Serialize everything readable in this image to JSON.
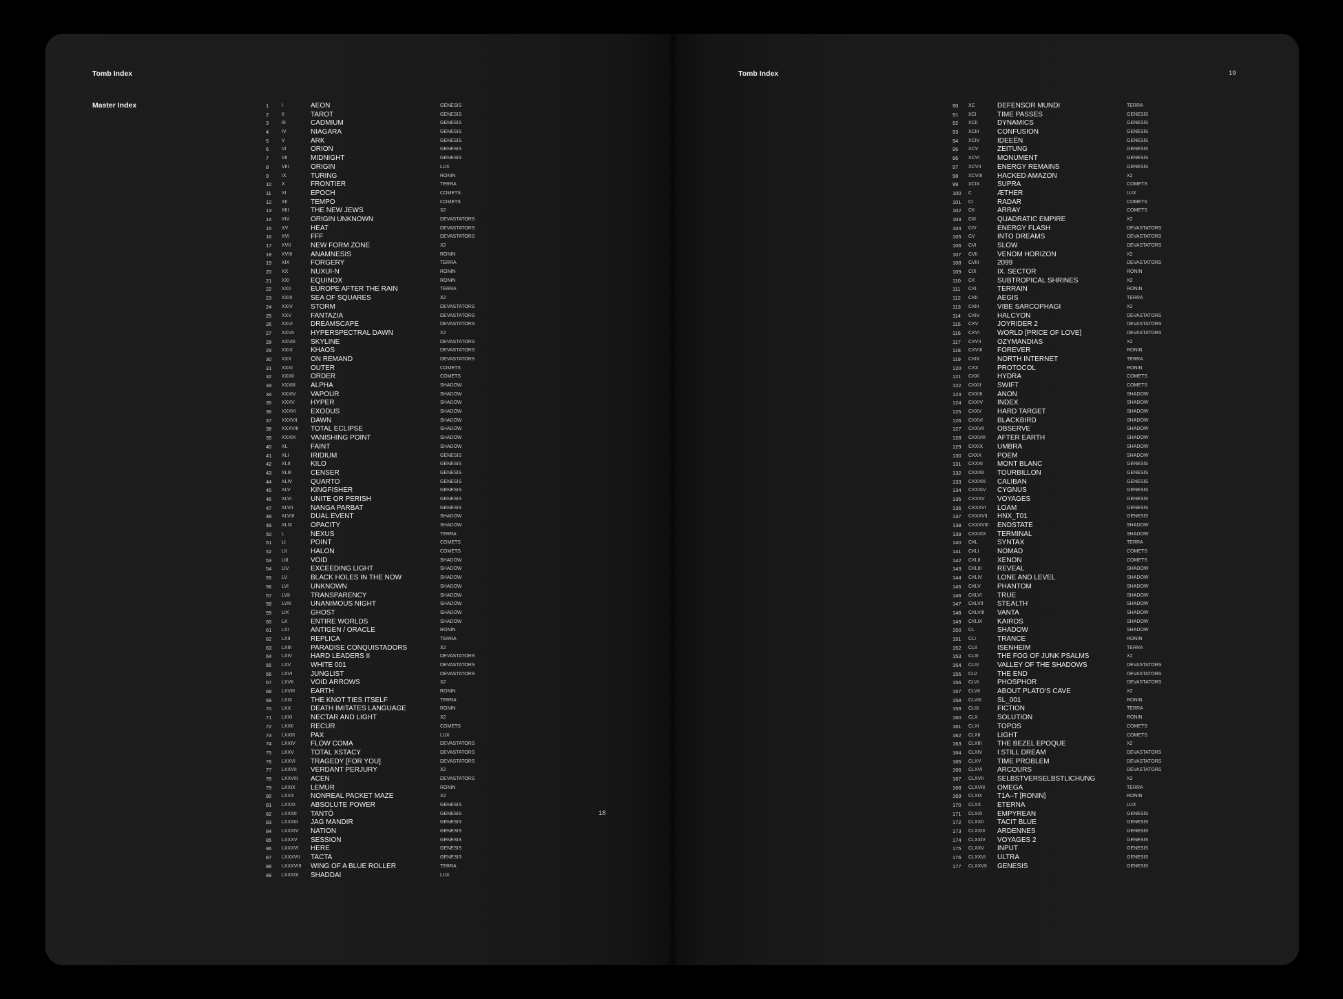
{
  "left_page": {
    "header": "Tomb Index",
    "section": "Master Index",
    "page_number": "18",
    "entries": [
      {
        "n": "1",
        "r": "I",
        "t": "AEON",
        "c": "GENESIS"
      },
      {
        "n": "2",
        "r": "II",
        "t": "TAROT",
        "c": "GENESIS"
      },
      {
        "n": "3",
        "r": "III",
        "t": "CADMIUM",
        "c": "GENESIS"
      },
      {
        "n": "4",
        "r": "IV",
        "t": "NIAGARA",
        "c": "GENESIS"
      },
      {
        "n": "5",
        "r": "V",
        "t": "ARK",
        "c": "GENESIS"
      },
      {
        "n": "6",
        "r": "VI",
        "t": "ORION",
        "c": "GENESIS"
      },
      {
        "n": "7",
        "r": "VII",
        "t": "MIDNIGHT",
        "c": "GENESIS"
      },
      {
        "n": "8",
        "r": "VIII",
        "t": "ORIGIN",
        "c": "LUX"
      },
      {
        "n": "9",
        "r": "IX",
        "t": "TURING",
        "c": "RONIN"
      },
      {
        "n": "10",
        "r": "X",
        "t": "FRONTIER",
        "c": "TERRA"
      },
      {
        "n": "11",
        "r": "XI",
        "t": "EPOCH",
        "c": "COMETS"
      },
      {
        "n": "12",
        "r": "XII",
        "t": "TEMPO",
        "c": "COMETS"
      },
      {
        "n": "13",
        "r": "XIII",
        "t": "THE NEW JEWS",
        "c": "X2"
      },
      {
        "n": "14",
        "r": "XIV",
        "t": "ORIGIN UNKNOWN",
        "c": "DEVASTATORS"
      },
      {
        "n": "15",
        "r": "XV",
        "t": "HEAT",
        "c": "DEVASTATORS"
      },
      {
        "n": "16",
        "r": "XVI",
        "t": "FFF",
        "c": "DEVASTATORS"
      },
      {
        "n": "17",
        "r": "XVII",
        "t": "NEW FORM ZONE",
        "c": "X2"
      },
      {
        "n": "18",
        "r": "XVIII",
        "t": "ANAMNESIS",
        "c": "RONIN"
      },
      {
        "n": "19",
        "r": "XIX",
        "t": "FORGERY",
        "c": "TERRA"
      },
      {
        "n": "20",
        "r": "XX",
        "t": "NUXUI-N",
        "c": "RONIN"
      },
      {
        "n": "21",
        "r": "XXI",
        "t": "EQUINOX",
        "c": "RONIN"
      },
      {
        "n": "22",
        "r": "XXII",
        "t": "EUROPE AFTER THE RAIN",
        "c": "TERRA"
      },
      {
        "n": "23",
        "r": "XXIII",
        "t": "SEA OF SQUARES",
        "c": "X2"
      },
      {
        "n": "24",
        "r": "XXIV",
        "t": "STORM",
        "c": "DEVASTATORS"
      },
      {
        "n": "25",
        "r": "XXV",
        "t": "FANTAZIA",
        "c": "DEVASTATORS"
      },
      {
        "n": "26",
        "r": "XXVI",
        "t": "DREAMSCAPE",
        "c": "DEVASTATORS"
      },
      {
        "n": "27",
        "r": "XXVII",
        "t": "HYPERSPECTRAL DAWN",
        "c": "X2"
      },
      {
        "n": "28",
        "r": "XXVIII",
        "t": "SKYLINE",
        "c": "DEVASTATORS"
      },
      {
        "n": "29",
        "r": "XXIX",
        "t": "KHAOS",
        "c": "DEVASTATORS"
      },
      {
        "n": "30",
        "r": "XXX",
        "t": "ON REMAND",
        "c": "DEVASTATORS"
      },
      {
        "n": "31",
        "r": "XXXI",
        "t": "OUTER",
        "c": "COMETS"
      },
      {
        "n": "32",
        "r": "XXXII",
        "t": "ORDER",
        "c": "COMETS"
      },
      {
        "n": "33",
        "r": "XXXIII",
        "t": "ALPHA",
        "c": "SHADOW"
      },
      {
        "n": "34",
        "r": "XXXIV",
        "t": "VAPOUR",
        "c": "SHADOW"
      },
      {
        "n": "35",
        "r": "XXXV",
        "t": "HYPER",
        "c": "SHADOW"
      },
      {
        "n": "36",
        "r": "XXXVI",
        "t": "EXODUS",
        "c": "SHADOW"
      },
      {
        "n": "37",
        "r": "XXXVII",
        "t": "DAWN",
        "c": "SHADOW"
      },
      {
        "n": "38",
        "r": "XXXVIII",
        "t": "TOTAL ECLIPSE",
        "c": "SHADOW"
      },
      {
        "n": "39",
        "r": "XXXIX",
        "t": "VANISHING POINT",
        "c": "SHADOW"
      },
      {
        "n": "40",
        "r": "XL",
        "t": "FAINT",
        "c": "SHADOW"
      },
      {
        "n": "41",
        "r": "XLI",
        "t": "IRIDIUM",
        "c": "GENESIS"
      },
      {
        "n": "42",
        "r": "XLII",
        "t": "KILO",
        "c": "GENESIS"
      },
      {
        "n": "43",
        "r": "XLIII",
        "t": "CENSER",
        "c": "GENESIS"
      },
      {
        "n": "44",
        "r": "XLIV",
        "t": "QUARTO",
        "c": "GENESIS"
      },
      {
        "n": "45",
        "r": "XLV",
        "t": "KINGFISHER",
        "c": "GENESIS"
      },
      {
        "n": "46",
        "r": "XLVI",
        "t": "UNITE OR PERISH",
        "c": "GENESIS"
      },
      {
        "n": "47",
        "r": "XLVII",
        "t": "NANGA PARBAT",
        "c": "GENESIS"
      },
      {
        "n": "48",
        "r": "XLVIII",
        "t": "DUAL EVENT",
        "c": "SHADOW"
      },
      {
        "n": "49",
        "r": "XLIX",
        "t": "OPACITY",
        "c": "SHADOW"
      },
      {
        "n": "50",
        "r": "L",
        "t": "NEXUS",
        "c": "TERRA"
      },
      {
        "n": "51",
        "r": "LI",
        "t": "POINT",
        "c": "COMETS"
      },
      {
        "n": "52",
        "r": "LII",
        "t": "HALON",
        "c": "COMETS"
      },
      {
        "n": "53",
        "r": "LIII",
        "t": "VOID",
        "c": "SHADOW"
      },
      {
        "n": "54",
        "r": "LIV",
        "t": "EXCEEDING LIGHT",
        "c": "SHADOW"
      },
      {
        "n": "55",
        "r": "LV",
        "t": "BLACK HOLES IN THE NOW",
        "c": "SHADOW"
      },
      {
        "n": "56",
        "r": "LVI",
        "t": "UNKNOWN",
        "c": "SHADOW"
      },
      {
        "n": "57",
        "r": "LVII",
        "t": "TRANSPARENCY",
        "c": "SHADOW"
      },
      {
        "n": "58",
        "r": "LVIII",
        "t": "UNANIMOUS NIGHT",
        "c": "SHADOW"
      },
      {
        "n": "59",
        "r": "LIX",
        "t": "GHOST",
        "c": "SHADOW"
      },
      {
        "n": "60",
        "r": "LX",
        "t": "ENTIRE WORLDS",
        "c": "SHADOW"
      },
      {
        "n": "61",
        "r": "LXI",
        "t": "ANTIGEN / ORACLE",
        "c": "RONIN"
      },
      {
        "n": "62",
        "r": "LXII",
        "t": "REPLICA",
        "c": "TERRA"
      },
      {
        "n": "63",
        "r": "LXIII",
        "t": "PARADISE CONQUISTADORS",
        "c": "X2"
      },
      {
        "n": "64",
        "r": "LXIV",
        "t": "HARD LEADERS II",
        "c": "DEVASTATORS"
      },
      {
        "n": "65",
        "r": "LXV",
        "t": "WHITE 001",
        "c": "DEVASTATORS"
      },
      {
        "n": "66",
        "r": "LXVI",
        "t": "JUNGLIST",
        "c": "DEVASTATORS"
      },
      {
        "n": "67",
        "r": "LXVII",
        "t": "VOID ARROWS",
        "c": "X2"
      },
      {
        "n": "68",
        "r": "LXVIII",
        "t": "EARTH",
        "c": "RONIN"
      },
      {
        "n": "69",
        "r": "LXIX",
        "t": "THE KNOT TIES ITSELF",
        "c": "TERRA"
      },
      {
        "n": "70",
        "r": "LXX",
        "t": "DEATH IMITATES LANGUAGE",
        "c": "RONIN"
      },
      {
        "n": "71",
        "r": "LXXI",
        "t": "NECTAR AND LIGHT",
        "c": "X2"
      },
      {
        "n": "72",
        "r": "LXXII",
        "t": "RECUR",
        "c": "COMETS"
      },
      {
        "n": "73",
        "r": "LXXIII",
        "t": "PAX",
        "c": "LUX"
      },
      {
        "n": "74",
        "r": "LXXIV",
        "t": "FLOW COMA",
        "c": "DEVASTATORS"
      },
      {
        "n": "75",
        "r": "LXXV",
        "t": "TOTAL XSTACY",
        "c": "DEVASTATORS"
      },
      {
        "n": "76",
        "r": "LXXVI",
        "t": "TRAGEDY [FOR YOU]",
        "c": "DEVASTATORS"
      },
      {
        "n": "77",
        "r": "LXXVII",
        "t": "VERDANT PERJURY",
        "c": "X2"
      },
      {
        "n": "78",
        "r": "LXXVIII",
        "t": "ACEN",
        "c": "DEVASTATORS"
      },
      {
        "n": "79",
        "r": "LXXIX",
        "t": "LEMUR",
        "c": "RONIN"
      },
      {
        "n": "80",
        "r": "LXXX",
        "t": "NONREAL PACKET MAZE",
        "c": "X2"
      },
      {
        "n": "81",
        "r": "LXXXI",
        "t": "ABSOLUTE POWER",
        "c": "GENESIS"
      },
      {
        "n": "82",
        "r": "LXXXII",
        "t": "TANTŌ",
        "c": "GENESIS"
      },
      {
        "n": "83",
        "r": "LXXXIII",
        "t": "JAG MANDIR",
        "c": "GENESIS"
      },
      {
        "n": "84",
        "r": "LXXXIV",
        "t": "NATION",
        "c": "GENESIS"
      },
      {
        "n": "85",
        "r": "LXXXV",
        "t": "SESSION",
        "c": "GENESIS"
      },
      {
        "n": "86",
        "r": "LXXXVI",
        "t": "HERE",
        "c": "GENESIS"
      },
      {
        "n": "87",
        "r": "LXXXVII",
        "t": "TACTA",
        "c": "GENESIS"
      },
      {
        "n": "88",
        "r": "LXXXVIII",
        "t": "WING OF A BLUE ROLLER",
        "c": "TERRA"
      },
      {
        "n": "89",
        "r": "LXXXIX",
        "t": "SHADDAI",
        "c": "LUX"
      }
    ]
  },
  "right_page": {
    "header": "Tomb Index",
    "page_number": "19",
    "entries": [
      {
        "n": "90",
        "r": "XC",
        "t": "DEFENSOR MUNDI",
        "c": "TERRA"
      },
      {
        "n": "91",
        "r": "XCI",
        "t": "TIME PASSES",
        "c": "GENESIS"
      },
      {
        "n": "92",
        "r": "XCII",
        "t": "DYNAMICS",
        "c": "GENESIS"
      },
      {
        "n": "93",
        "r": "XCIII",
        "t": "CONFUSION",
        "c": "GENESIS"
      },
      {
        "n": "94",
        "r": "XCIV",
        "t": "IDEEËN",
        "c": "GENESIS"
      },
      {
        "n": "95",
        "r": "XCV",
        "t": "ZEITUNG",
        "c": "GENESIS"
      },
      {
        "n": "96",
        "r": "XCVI",
        "t": "MONUMENT",
        "c": "GENESIS"
      },
      {
        "n": "97",
        "r": "XCVII",
        "t": "ENERGY REMAINS",
        "c": "GENESIS"
      },
      {
        "n": "98",
        "r": "XCVIII",
        "t": "HACKED AMAZON",
        "c": "X2"
      },
      {
        "n": "99",
        "r": "XCIX",
        "t": "SUPRA",
        "c": "COMETS"
      },
      {
        "n": "100",
        "r": "C",
        "t": "ÆTHER",
        "c": "LUX"
      },
      {
        "n": "101",
        "r": "CI",
        "t": "RADAR",
        "c": "COMETS"
      },
      {
        "n": "102",
        "r": "CII",
        "t": "ARRAY",
        "c": "COMETS"
      },
      {
        "n": "103",
        "r": "CIII",
        "t": "QUADRATIC EMPIRE",
        "c": "X2"
      },
      {
        "n": "104",
        "r": "CIV",
        "t": "ENERGY FLASH",
        "c": "DEVASTATORS"
      },
      {
        "n": "105",
        "r": "CV",
        "t": "INTO DREAMS",
        "c": "DEVASTATORS"
      },
      {
        "n": "106",
        "r": "CVI",
        "t": "SLOW",
        "c": "DEVASTATORS"
      },
      {
        "n": "107",
        "r": "CVII",
        "t": "VENOM HORIZON",
        "c": "X2"
      },
      {
        "n": "108",
        "r": "CVIII",
        "t": "2099",
        "c": "DEVASTATORS"
      },
      {
        "n": "109",
        "r": "CIX",
        "t": "IX. SECTOR",
        "c": "RONIN"
      },
      {
        "n": "110",
        "r": "CX",
        "t": "SUBTROPICAL SHRINES",
        "c": "X2"
      },
      {
        "n": "111",
        "r": "CXI",
        "t": "TERRAIN",
        "c": "RONIN"
      },
      {
        "n": "112",
        "r": "CXII",
        "t": "AEGIS",
        "c": "TERRA"
      },
      {
        "n": "113",
        "r": "CXIII",
        "t": "VIBE SARCOPHAGI",
        "c": "X2"
      },
      {
        "n": "114",
        "r": "CXIV",
        "t": "HALCYON",
        "c": "DEVASTATORS"
      },
      {
        "n": "115",
        "r": "CXV",
        "t": "JOYRIDER 2",
        "c": "DEVASTATORS"
      },
      {
        "n": "116",
        "r": "CXVI",
        "t": "WORLD [PRICE OF LOVE]",
        "c": "DEVASTATORS"
      },
      {
        "n": "117",
        "r": "CXVII",
        "t": "OZYMANDIAS",
        "c": "X2"
      },
      {
        "n": "118",
        "r": "CXVIII",
        "t": "FOREVER",
        "c": "RONIN"
      },
      {
        "n": "119",
        "r": "CXIX",
        "t": "NORTH INTERNET",
        "c": "TERRA"
      },
      {
        "n": "120",
        "r": "CXX",
        "t": "PROTOCOL",
        "c": "RONIN"
      },
      {
        "n": "121",
        "r": "CXXI",
        "t": "HYDRA",
        "c": "COMETS"
      },
      {
        "n": "122",
        "r": "CXXII",
        "t": "SWIFT",
        "c": "COMETS"
      },
      {
        "n": "123",
        "r": "CXXIII",
        "t": "ANON",
        "c": "SHADOW"
      },
      {
        "n": "124",
        "r": "CXXIV",
        "t": "INDEX",
        "c": "SHADOW"
      },
      {
        "n": "125",
        "r": "CXXV",
        "t": "HARD TARGET",
        "c": "SHADOW"
      },
      {
        "n": "126",
        "r": "CXXVI",
        "t": "BLACKBIRD",
        "c": "SHADOW"
      },
      {
        "n": "127",
        "r": "CXXVII",
        "t": "OBSERVE",
        "c": "SHADOW"
      },
      {
        "n": "128",
        "r": "CXXVIII",
        "t": "AFTER EARTH",
        "c": "SHADOW"
      },
      {
        "n": "129",
        "r": "CXXIX",
        "t": "UMBRA",
        "c": "SHADOW"
      },
      {
        "n": "130",
        "r": "CXXX",
        "t": "POEM",
        "c": "SHADOW"
      },
      {
        "n": "131",
        "r": "CXXXI",
        "t": "MONT BLANC",
        "c": "GENESIS"
      },
      {
        "n": "132",
        "r": "CXXXII",
        "t": "TOURBILLON",
        "c": "GENESIS"
      },
      {
        "n": "133",
        "r": "CXXXIII",
        "t": "CALIBAN",
        "c": "GENESIS"
      },
      {
        "n": "134",
        "r": "CXXXIV",
        "t": "CYGNUS",
        "c": "GENESIS"
      },
      {
        "n": "135",
        "r": "CXXXV",
        "t": "VOYAGES",
        "c": "GENESIS"
      },
      {
        "n": "136",
        "r": "CXXXVI",
        "t": "LOAM",
        "c": "GENESIS"
      },
      {
        "n": "137",
        "r": "CXXXVII",
        "t": "HNX_T01",
        "c": "GENESIS"
      },
      {
        "n": "138",
        "r": "CXXXVIII",
        "t": "ENDSTATE",
        "c": "SHADOW"
      },
      {
        "n": "139",
        "r": "CXXXIX",
        "t": "TERMINAL",
        "c": "SHADOW"
      },
      {
        "n": "140",
        "r": "CXL",
        "t": "SYNTAX",
        "c": "TERRA"
      },
      {
        "n": "141",
        "r": "CXLI",
        "t": "NOMAD",
        "c": "COMETS"
      },
      {
        "n": "142",
        "r": "CXLII",
        "t": "XENON",
        "c": "COMETS"
      },
      {
        "n": "143",
        "r": "CXLIII",
        "t": "REVEAL",
        "c": "SHADOW"
      },
      {
        "n": "144",
        "r": "CXLIV",
        "t": "LONE AND LEVEL",
        "c": "SHADOW"
      },
      {
        "n": "145",
        "r": "CXLV",
        "t": "PHANTOM",
        "c": "SHADOW"
      },
      {
        "n": "146",
        "r": "CXLVI",
        "t": "TRUE",
        "c": "SHADOW"
      },
      {
        "n": "147",
        "r": "CXLVII",
        "t": "STEALTH",
        "c": "SHADOW"
      },
      {
        "n": "148",
        "r": "CXLVIII",
        "t": "VANTA",
        "c": "SHADOW"
      },
      {
        "n": "149",
        "r": "CXLIX",
        "t": "KAIROS",
        "c": "SHADOW"
      },
      {
        "n": "150",
        "r": "CL",
        "t": "SHADOW",
        "c": "SHADOW"
      },
      {
        "n": "151",
        "r": "CLI",
        "t": "TRANCE",
        "c": "RONIN"
      },
      {
        "n": "152",
        "r": "CLII",
        "t": "ISENHEIM",
        "c": "TERRA"
      },
      {
        "n": "153",
        "r": "CLIII",
        "t": "THE FOG OF JUNK PSALMS",
        "c": "X2"
      },
      {
        "n": "154",
        "r": "CLIV",
        "t": "VALLEY OF THE SHADOWS",
        "c": "DEVASTATORS"
      },
      {
        "n": "155",
        "r": "CLV",
        "t": "THE END",
        "c": "DEVASTATORS"
      },
      {
        "n": "156",
        "r": "CLVI",
        "t": "PHOSPHOR",
        "c": "DEVASTATORS"
      },
      {
        "n": "157",
        "r": "CLVII",
        "t": "ABOUT PLATO'S CAVE",
        "c": "X2"
      },
      {
        "n": "158",
        "r": "CLVIII",
        "t": "SL_001",
        "c": "RONIN"
      },
      {
        "n": "159",
        "r": "CLIX",
        "t": "FICTION",
        "c": "TERRA"
      },
      {
        "n": "160",
        "r": "CLX",
        "t": "SOLUTION",
        "c": "RONIN"
      },
      {
        "n": "161",
        "r": "CLXI",
        "t": "TOPOS",
        "c": "COMETS"
      },
      {
        "n": "162",
        "r": "CLXII",
        "t": "LIGHT",
        "c": "COMETS"
      },
      {
        "n": "163",
        "r": "CLXIII",
        "t": "THE BEZEL EPOQUE",
        "c": "X2"
      },
      {
        "n": "164",
        "r": "CLXIV",
        "t": "I STILL DREAM",
        "c": "DEVASTATORS"
      },
      {
        "n": "165",
        "r": "CLXV",
        "t": "TIME PROBLEM",
        "c": "DEVASTATORS"
      },
      {
        "n": "166",
        "r": "CLXVI",
        "t": "ARCOURS",
        "c": "DEVASTATORS"
      },
      {
        "n": "167",
        "r": "CLXVII",
        "t": "SELBSTVERSELBSTLICHUNG",
        "c": "X2"
      },
      {
        "n": "168",
        "r": "CLXVIII",
        "t": "OMEGA",
        "c": "TERRA"
      },
      {
        "n": "169",
        "r": "CLXIX",
        "t": "T1A–T [RONIN]",
        "c": "RONIN"
      },
      {
        "n": "170",
        "r": "CLXX",
        "t": "ETERNA",
        "c": "LUX"
      },
      {
        "n": "171",
        "r": "CLXXI",
        "t": "EMPYREAN",
        "c": "GENESIS"
      },
      {
        "n": "172",
        "r": "CLXXII",
        "t": "TACIT BLUE",
        "c": "GENESIS"
      },
      {
        "n": "173",
        "r": "CLXXIII",
        "t": "ARDENNES",
        "c": "GENESIS"
      },
      {
        "n": "174",
        "r": "CLXXIV",
        "t": "VOYAGES 2",
        "c": "GENESIS"
      },
      {
        "n": "175",
        "r": "CLXXV",
        "t": "INPUT",
        "c": "GENESIS"
      },
      {
        "n": "176",
        "r": "CLXXVI",
        "t": "ULTRA",
        "c": "GENESIS"
      },
      {
        "n": "177",
        "r": "CLXXVII",
        "t": "GENESIS",
        "c": "GENESIS"
      }
    ]
  }
}
